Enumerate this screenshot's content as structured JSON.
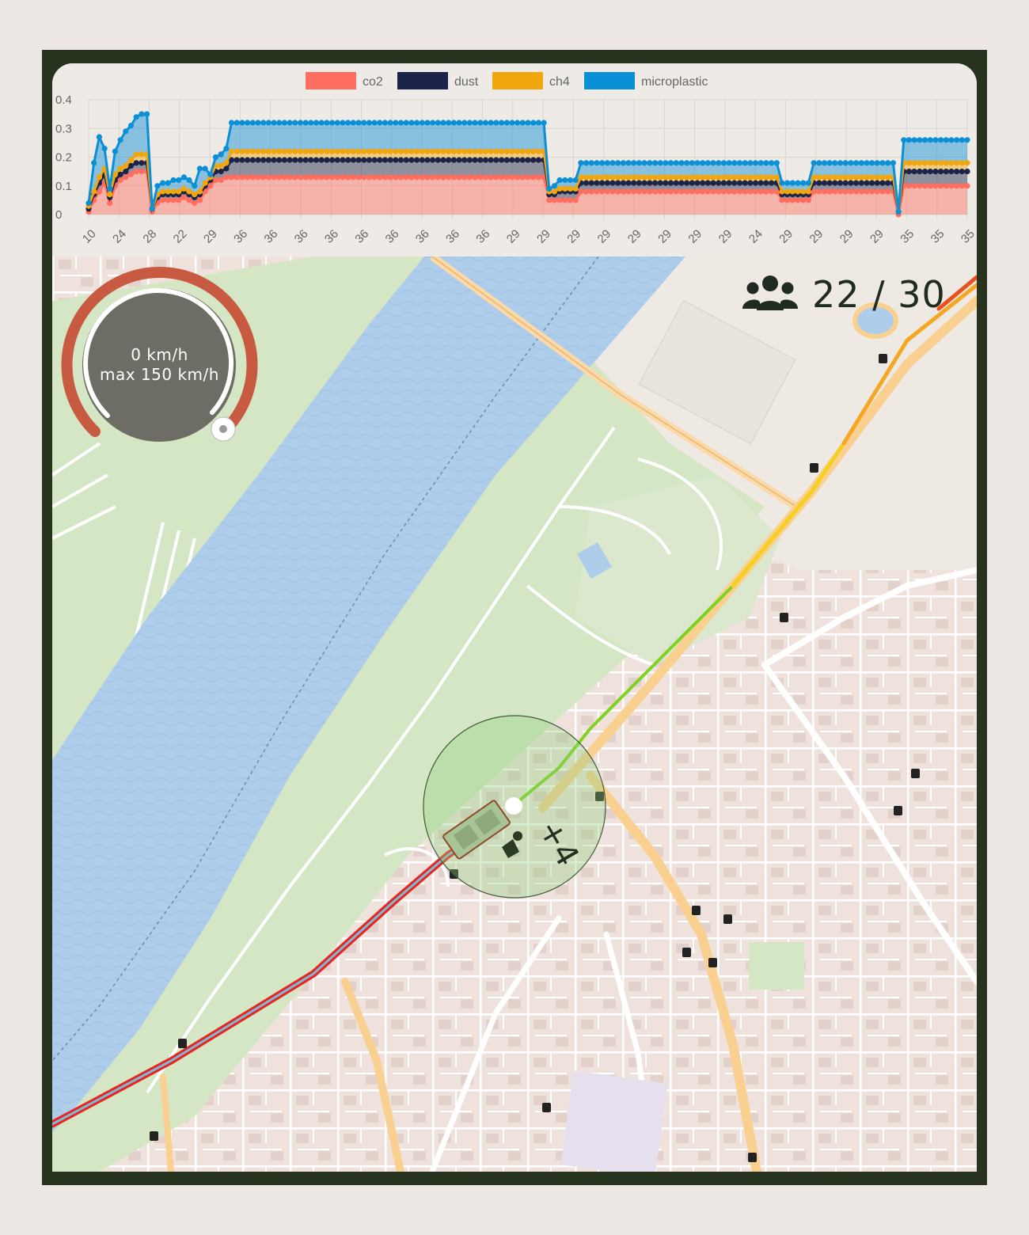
{
  "speedometer": {
    "speed_text": "0 km/h",
    "max_text": "max 150 km/h",
    "speed_kmh": 0,
    "max_kmh": 150
  },
  "players": {
    "icon": "users-icon",
    "count_text": "22 / 30"
  },
  "vehicle_marker": {
    "plus_text": "+4",
    "passenger_icon": "passenger-icon"
  },
  "map": {
    "water_color": "#aecdeb",
    "park_color": "#d4e6c4",
    "road_color": "#ffffff",
    "major_road_color": "#f9d08f",
    "route_red": "#e8241e",
    "route_green": "#7ed321",
    "route_orange": "#f5a623",
    "bus_stop_icon": "bus-stop-icon"
  },
  "chart_data": {
    "type": "area",
    "stacked": true,
    "legend_position": "top",
    "grid": true,
    "ylim": [
      0,
      0.4
    ],
    "yticks": [
      "0",
      "0.1",
      "0.2",
      "0.3",
      "0.4"
    ],
    "xtick_labels": [
      "10",
      "24",
      "28",
      "22",
      "29",
      "36",
      "36",
      "36",
      "36",
      "36",
      "36",
      "36",
      "36",
      "36",
      "29",
      "29",
      "29",
      "29",
      "29",
      "29",
      "29",
      "29",
      "24",
      "29",
      "29",
      "29",
      "29",
      "35",
      "35",
      "35"
    ],
    "series": [
      {
        "name": "co2",
        "color": "#ff6e5e",
        "values": [
          0.01,
          0.05,
          0.08,
          0.11,
          0.04,
          0.1,
          0.12,
          0.13,
          0.14,
          0.15,
          0.15,
          0.15,
          0.01,
          0.04,
          0.05,
          0.05,
          0.05,
          0.05,
          0.06,
          0.05,
          0.04,
          0.05,
          0.08,
          0.1,
          0.12,
          0.12,
          0.13,
          0.13,
          0.13,
          0.13,
          0.13,
          0.13,
          0.13,
          0.13,
          0.13,
          0.13,
          0.13,
          0.13,
          0.13,
          0.13,
          0.13,
          0.13,
          0.13,
          0.13,
          0.13,
          0.13,
          0.13,
          0.13,
          0.13,
          0.13,
          0.13,
          0.13,
          0.13,
          0.13,
          0.13,
          0.13,
          0.13,
          0.13,
          0.13,
          0.13,
          0.13,
          0.13,
          0.13,
          0.13,
          0.13,
          0.13,
          0.13,
          0.13,
          0.13,
          0.13,
          0.13,
          0.13,
          0.13,
          0.13,
          0.13,
          0.13,
          0.13,
          0.13,
          0.13,
          0.13,
          0.13,
          0.13,
          0.13,
          0.13,
          0.13,
          0.13,
          0.13,
          0.05,
          0.05,
          0.05,
          0.05,
          0.05,
          0.05,
          0.08,
          0.08,
          0.08,
          0.08,
          0.08,
          0.08,
          0.08,
          0.08,
          0.08,
          0.08,
          0.08,
          0.08,
          0.08,
          0.08,
          0.08,
          0.08,
          0.08,
          0.08,
          0.08,
          0.08,
          0.08,
          0.08,
          0.08,
          0.08,
          0.08,
          0.08,
          0.08,
          0.08,
          0.08,
          0.08,
          0.08,
          0.08,
          0.08,
          0.08,
          0.08,
          0.08,
          0.08,
          0.08,
          0.05,
          0.05,
          0.05,
          0.05,
          0.05,
          0.05,
          0.08,
          0.08,
          0.08,
          0.08,
          0.08,
          0.08,
          0.08,
          0.08,
          0.08,
          0.08,
          0.08,
          0.08,
          0.08,
          0.08,
          0.08,
          0.08,
          0.0,
          0.1,
          0.1,
          0.1,
          0.1,
          0.1,
          0.1,
          0.1,
          0.1,
          0.1,
          0.1,
          0.1,
          0.1,
          0.1
        ]
      },
      {
        "name": "dust",
        "color": "#1b2448",
        "values": [
          0.01,
          0.02,
          0.03,
          0.03,
          0.02,
          0.02,
          0.02,
          0.02,
          0.03,
          0.03,
          0.03,
          0.03,
          0.01,
          0.02,
          0.02,
          0.02,
          0.02,
          0.02,
          0.02,
          0.02,
          0.02,
          0.02,
          0.02,
          0.02,
          0.03,
          0.03,
          0.03,
          0.06,
          0.06,
          0.06,
          0.06,
          0.06,
          0.06,
          0.06,
          0.06,
          0.06,
          0.06,
          0.06,
          0.06,
          0.06,
          0.06,
          0.06,
          0.06,
          0.06,
          0.06,
          0.06,
          0.06,
          0.06,
          0.06,
          0.06,
          0.06,
          0.06,
          0.06,
          0.06,
          0.06,
          0.06,
          0.06,
          0.06,
          0.06,
          0.06,
          0.06,
          0.06,
          0.06,
          0.06,
          0.06,
          0.06,
          0.06,
          0.06,
          0.06,
          0.06,
          0.06,
          0.06,
          0.06,
          0.06,
          0.06,
          0.06,
          0.06,
          0.06,
          0.06,
          0.06,
          0.06,
          0.06,
          0.06,
          0.06,
          0.06,
          0.06,
          0.06,
          0.02,
          0.02,
          0.03,
          0.03,
          0.03,
          0.03,
          0.03,
          0.03,
          0.03,
          0.03,
          0.03,
          0.03,
          0.03,
          0.03,
          0.03,
          0.03,
          0.03,
          0.03,
          0.03,
          0.03,
          0.03,
          0.03,
          0.03,
          0.03,
          0.03,
          0.03,
          0.03,
          0.03,
          0.03,
          0.03,
          0.03,
          0.03,
          0.03,
          0.03,
          0.03,
          0.03,
          0.03,
          0.03,
          0.03,
          0.03,
          0.03,
          0.03,
          0.03,
          0.03,
          0.02,
          0.02,
          0.02,
          0.02,
          0.02,
          0.02,
          0.03,
          0.03,
          0.03,
          0.03,
          0.03,
          0.03,
          0.03,
          0.03,
          0.03,
          0.03,
          0.03,
          0.03,
          0.03,
          0.03,
          0.03,
          0.03,
          0.01,
          0.05,
          0.05,
          0.05,
          0.05,
          0.05,
          0.05,
          0.05,
          0.05,
          0.05,
          0.05,
          0.05,
          0.05,
          0.05
        ]
      },
      {
        "name": "ch4",
        "color": "#f2a60d",
        "values": [
          0.01,
          0.01,
          0.02,
          0.02,
          0.01,
          0.02,
          0.02,
          0.02,
          0.02,
          0.03,
          0.03,
          0.03,
          0.0,
          0.01,
          0.01,
          0.01,
          0.01,
          0.01,
          0.01,
          0.01,
          0.01,
          0.01,
          0.01,
          0.01,
          0.02,
          0.02,
          0.02,
          0.03,
          0.03,
          0.03,
          0.03,
          0.03,
          0.03,
          0.03,
          0.03,
          0.03,
          0.03,
          0.03,
          0.03,
          0.03,
          0.03,
          0.03,
          0.03,
          0.03,
          0.03,
          0.03,
          0.03,
          0.03,
          0.03,
          0.03,
          0.03,
          0.03,
          0.03,
          0.03,
          0.03,
          0.03,
          0.03,
          0.03,
          0.03,
          0.03,
          0.03,
          0.03,
          0.03,
          0.03,
          0.03,
          0.03,
          0.03,
          0.03,
          0.03,
          0.03,
          0.03,
          0.03,
          0.03,
          0.03,
          0.03,
          0.03,
          0.03,
          0.03,
          0.03,
          0.03,
          0.03,
          0.03,
          0.03,
          0.03,
          0.03,
          0.03,
          0.03,
          0.01,
          0.01,
          0.01,
          0.01,
          0.01,
          0.01,
          0.02,
          0.02,
          0.02,
          0.02,
          0.02,
          0.02,
          0.02,
          0.02,
          0.02,
          0.02,
          0.02,
          0.02,
          0.02,
          0.02,
          0.02,
          0.02,
          0.02,
          0.02,
          0.02,
          0.02,
          0.02,
          0.02,
          0.02,
          0.02,
          0.02,
          0.02,
          0.02,
          0.02,
          0.02,
          0.02,
          0.02,
          0.02,
          0.02,
          0.02,
          0.02,
          0.02,
          0.02,
          0.02,
          0.01,
          0.01,
          0.01,
          0.01,
          0.01,
          0.01,
          0.02,
          0.02,
          0.02,
          0.02,
          0.02,
          0.02,
          0.02,
          0.02,
          0.02,
          0.02,
          0.02,
          0.02,
          0.02,
          0.02,
          0.02,
          0.02,
          0.0,
          0.03,
          0.03,
          0.03,
          0.03,
          0.03,
          0.03,
          0.03,
          0.03,
          0.03,
          0.03,
          0.03,
          0.03,
          0.03
        ]
      },
      {
        "name": "microplastic",
        "color": "#0b8fd6",
        "values": [
          0.01,
          0.1,
          0.14,
          0.07,
          0.02,
          0.08,
          0.1,
          0.12,
          0.12,
          0.13,
          0.14,
          0.14,
          0.0,
          0.03,
          0.03,
          0.03,
          0.04,
          0.04,
          0.04,
          0.04,
          0.03,
          0.08,
          0.05,
          0.01,
          0.03,
          0.04,
          0.05,
          0.1,
          0.1,
          0.1,
          0.1,
          0.1,
          0.1,
          0.1,
          0.1,
          0.1,
          0.1,
          0.1,
          0.1,
          0.1,
          0.1,
          0.1,
          0.1,
          0.1,
          0.1,
          0.1,
          0.1,
          0.1,
          0.1,
          0.1,
          0.1,
          0.1,
          0.1,
          0.1,
          0.1,
          0.1,
          0.1,
          0.1,
          0.1,
          0.1,
          0.1,
          0.1,
          0.1,
          0.1,
          0.1,
          0.1,
          0.1,
          0.1,
          0.1,
          0.1,
          0.1,
          0.1,
          0.1,
          0.1,
          0.1,
          0.1,
          0.1,
          0.1,
          0.1,
          0.1,
          0.1,
          0.1,
          0.1,
          0.1,
          0.1,
          0.1,
          0.1,
          0.01,
          0.02,
          0.03,
          0.03,
          0.03,
          0.03,
          0.05,
          0.05,
          0.05,
          0.05,
          0.05,
          0.05,
          0.05,
          0.05,
          0.05,
          0.05,
          0.05,
          0.05,
          0.05,
          0.05,
          0.05,
          0.05,
          0.05,
          0.05,
          0.05,
          0.05,
          0.05,
          0.05,
          0.05,
          0.05,
          0.05,
          0.05,
          0.05,
          0.05,
          0.05,
          0.05,
          0.05,
          0.05,
          0.05,
          0.05,
          0.05,
          0.05,
          0.05,
          0.05,
          0.03,
          0.03,
          0.03,
          0.03,
          0.03,
          0.03,
          0.05,
          0.05,
          0.05,
          0.05,
          0.05,
          0.05,
          0.05,
          0.05,
          0.05,
          0.05,
          0.05,
          0.05,
          0.05,
          0.05,
          0.05,
          0.05,
          0.0,
          0.08,
          0.08,
          0.08,
          0.08,
          0.08,
          0.08,
          0.08,
          0.08,
          0.08,
          0.08,
          0.08,
          0.08,
          0.08
        ]
      }
    ]
  }
}
